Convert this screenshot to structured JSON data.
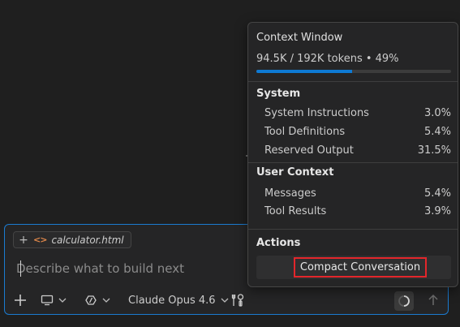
{
  "chat": {
    "file_chip": {
      "add_icon": "plus-icon",
      "file_icon": "code-brackets-icon",
      "file_name": "calculator.html"
    },
    "input": {
      "placeholder": "Describe what to build next",
      "value": ""
    },
    "toolbar": {
      "add_icon": "plus-icon",
      "device_icon": "monitor-icon",
      "mode_icon": "mode-icon",
      "model_label": "Claude Opus 4.6",
      "tools_icon": "tools-icon",
      "progress_icon": "spinner-icon",
      "send_icon": "arrow-up-icon"
    }
  },
  "context_popup": {
    "title": "Context Window",
    "usage_text": "94.5K / 192K tokens • 49%",
    "usage_percent": 49,
    "system": {
      "heading": "System",
      "items": [
        {
          "label": "System Instructions",
          "value": "3.0%"
        },
        {
          "label": "Tool Definitions",
          "value": "5.4%"
        },
        {
          "label": "Reserved Output",
          "value": "31.5%"
        }
      ]
    },
    "user_context": {
      "heading": "User Context",
      "items": [
        {
          "label": "Messages",
          "value": "5.4%"
        },
        {
          "label": "Tool Results",
          "value": "3.9%"
        }
      ]
    },
    "actions": {
      "heading": "Actions",
      "compact_label": "Compact Conversation"
    }
  },
  "colors": {
    "accent": "#0e7ad4",
    "focus_border": "#1b7bd0",
    "highlight_border": "#e3262b",
    "file_icon": "#e0884b"
  }
}
